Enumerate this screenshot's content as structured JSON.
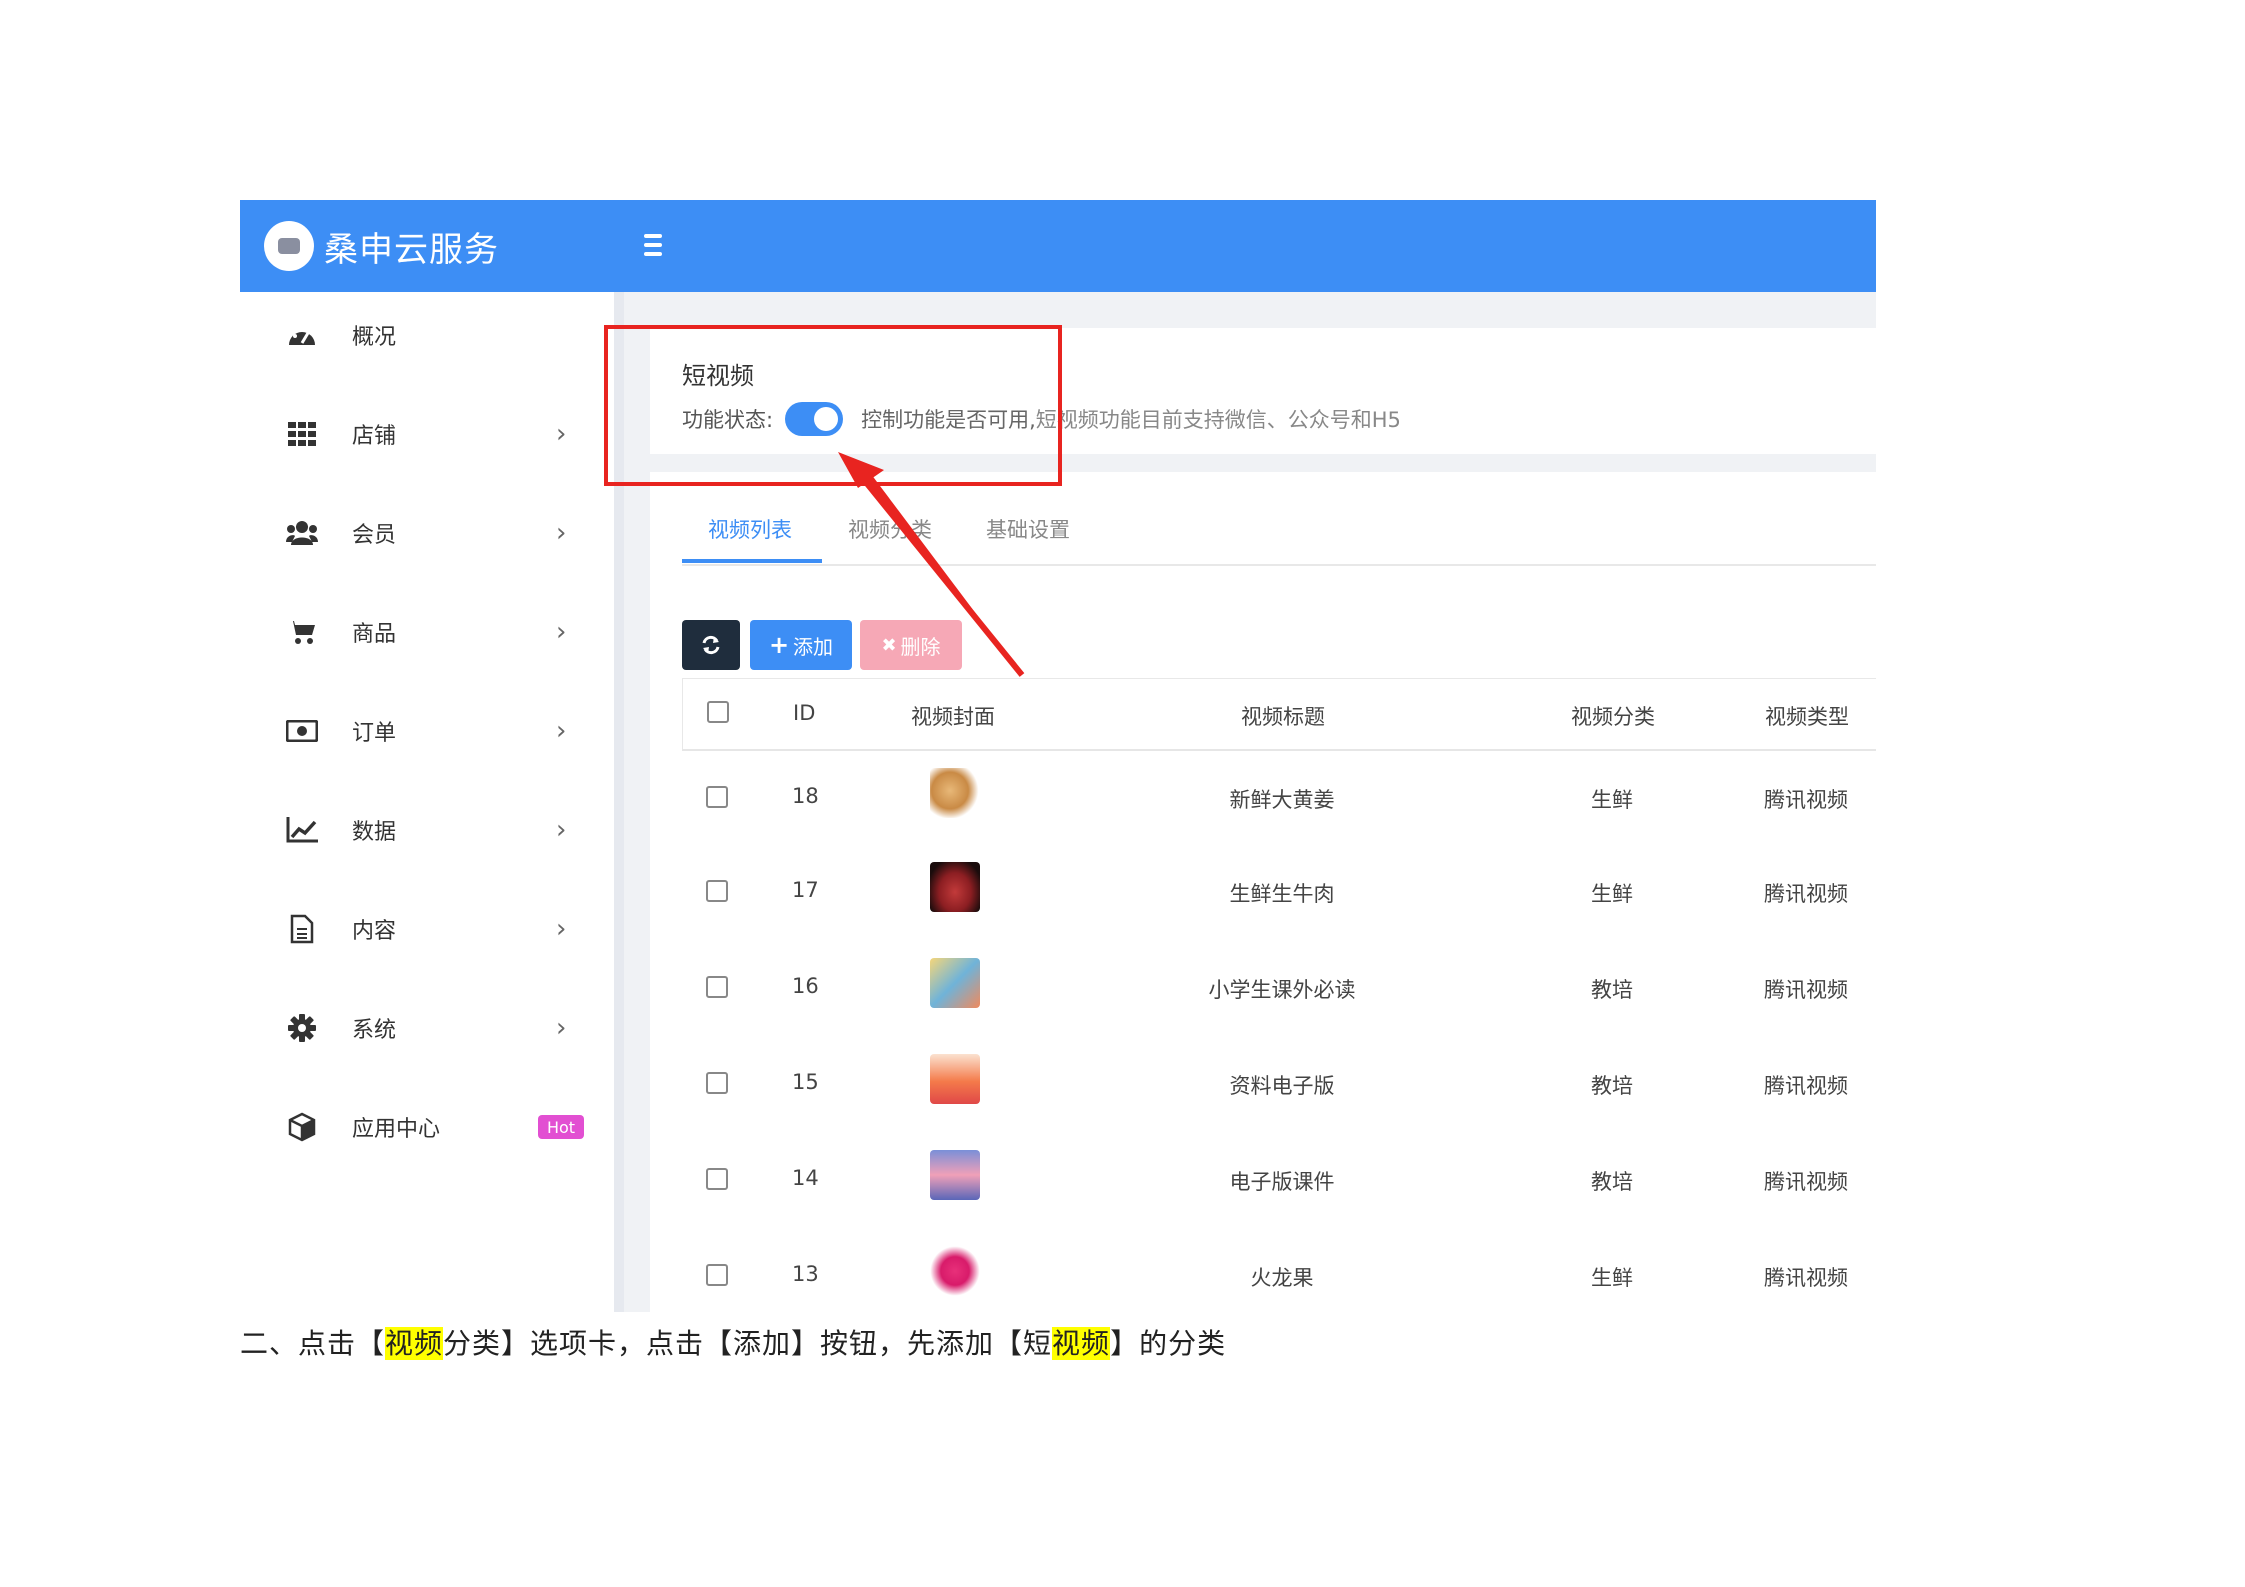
{
  "app": {
    "brand": "桑申云服务"
  },
  "sidebar": {
    "items": [
      {
        "label": "概况",
        "icon": "dashboard-icon",
        "has_chevron": false
      },
      {
        "label": "店铺",
        "icon": "grid-icon",
        "has_chevron": true
      },
      {
        "label": "会员",
        "icon": "users-icon",
        "has_chevron": true
      },
      {
        "label": "商品",
        "icon": "cart-icon",
        "has_chevron": true
      },
      {
        "label": "订单",
        "icon": "money-icon",
        "has_chevron": true
      },
      {
        "label": "数据",
        "icon": "chart-icon",
        "has_chevron": true
      },
      {
        "label": "内容",
        "icon": "document-icon",
        "has_chevron": true
      },
      {
        "label": "系统",
        "icon": "gear-icon",
        "has_chevron": true
      },
      {
        "label": "应用中心",
        "icon": "cube-icon",
        "badge": "Hot"
      }
    ],
    "chevron": "›"
  },
  "feature": {
    "title": "短视频",
    "status_label": "功能状态:",
    "enabled": true,
    "desc_main": "控制功能是否可用,",
    "desc_extra": "短视频功能目前支持微信、公众号和H5"
  },
  "tabs": [
    {
      "label": "视频列表",
      "active": true
    },
    {
      "label": "视频分类",
      "active": false
    },
    {
      "label": "基础设置",
      "active": false
    }
  ],
  "toolbar": {
    "add_label": "添加",
    "delete_label": "删除"
  },
  "table": {
    "headers": [
      "ID",
      "视频封面",
      "视频标题",
      "视频分类",
      "视频类型"
    ],
    "rows": [
      {
        "id": "18",
        "title": "新鲜大黄姜",
        "category": "生鲜",
        "type": "腾讯视频"
      },
      {
        "id": "17",
        "title": "生鲜生牛肉",
        "category": "生鲜",
        "type": "腾讯视频"
      },
      {
        "id": "16",
        "title": "小学生课外必读",
        "category": "教培",
        "type": "腾讯视频"
      },
      {
        "id": "15",
        "title": "资料电子版",
        "category": "教培",
        "type": "腾讯视频"
      },
      {
        "id": "14",
        "title": "电子版课件",
        "category": "教培",
        "type": "腾讯视频"
      },
      {
        "id": "13",
        "title": "火龙果",
        "category": "生鲜",
        "type": "腾讯视频"
      }
    ]
  },
  "caption": {
    "p1": "二、点击【",
    "h1": "视频",
    "p2": "分类】选项卡，点击【添加】按钮，先添加【短",
    "h2": "视频",
    "p3": "】的分类"
  },
  "colors": {
    "primary": "#3d8ef5",
    "annotation": "#e82420",
    "hot": "#e24fd2",
    "highlight": "#ffff00"
  }
}
